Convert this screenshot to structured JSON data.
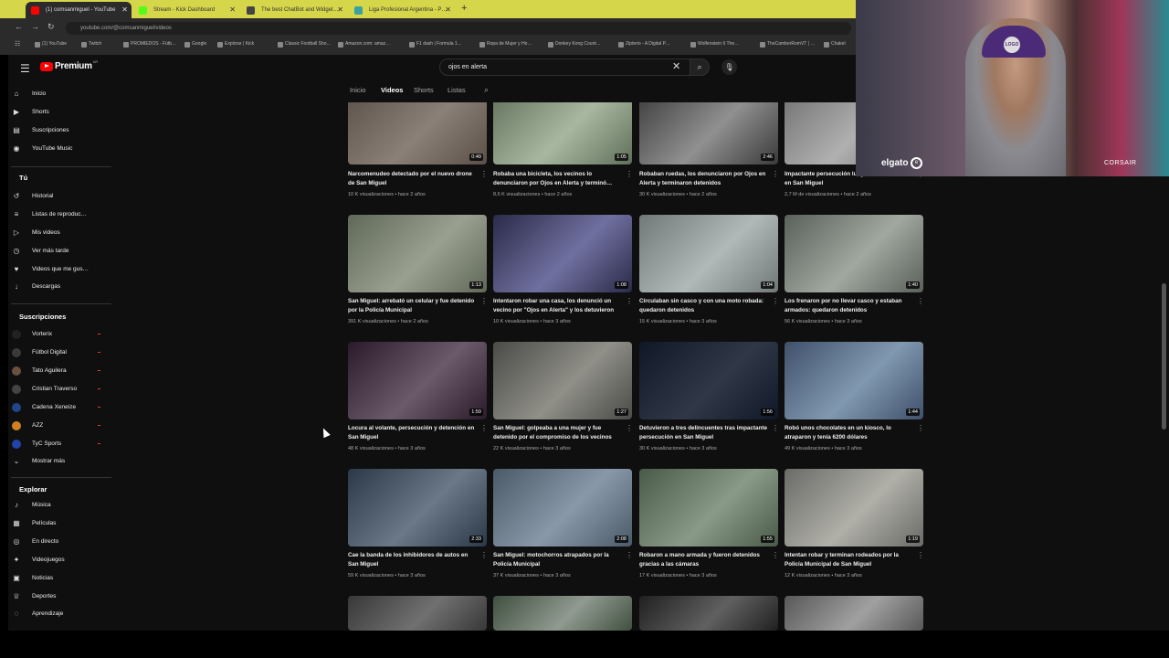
{
  "browser": {
    "tabs": [
      {
        "label": "(1) comsanmiguel - YouTube",
        "color": "#ff0000"
      },
      {
        "label": "Stream - Kick Dashboard",
        "color": "#53fc18"
      },
      {
        "label": "The best ChatBot and Widget…",
        "color": "#444444"
      },
      {
        "label": "Liga Profesional Argentina - P…",
        "color": "#3aa0a0"
      }
    ],
    "url": "youtube.com/@comsanmiguel/videos",
    "bookmarks": [
      "(1) YouTube",
      "Twitch",
      "PROMIEDOS - Fútb…",
      "Google",
      "Explorar | Kick",
      "Classic Football Sho…",
      "Amazon.com: amaz…",
      "F1 dash | Formula 1…",
      "Ropa de Mujer y Ho…",
      "Donkey Kong Count…",
      "Zipterio - A Digital P…",
      "Wolfenstein II The…",
      "TheCamberRomVT | …",
      "Chakel"
    ]
  },
  "header": {
    "logo": "Premium",
    "region": "AR",
    "search_value": "ojos en alerta"
  },
  "channel_tabs": [
    "Inicio",
    "Videos",
    "Shorts",
    "Listas"
  ],
  "sidebar": {
    "main": [
      "Inicio",
      "Shorts",
      "Suscripciones",
      "YouTube Music"
    ],
    "you_title": "Tú",
    "you": [
      "Historial",
      "Listas de reproduc…",
      "Mis videos",
      "Ver más tarde",
      "Videos que me gus…",
      "Descargas"
    ],
    "subs_title": "Suscripciones",
    "subs": [
      {
        "name": "Vorterix",
        "color": "#222222"
      },
      {
        "name": "Fútbol Digital",
        "color": "#3a3a3a"
      },
      {
        "name": "Tato Aguilera",
        "color": "#6a5040"
      },
      {
        "name": "Cristian Traverso",
        "color": "#444444"
      },
      {
        "name": "Cadena Xeneize",
        "color": "#224488"
      },
      {
        "name": "AZZ",
        "color": "#d08020"
      },
      {
        "name": "TyC Sports",
        "color": "#2244aa"
      }
    ],
    "show_more": "Mostrar más",
    "explore_title": "Explorar",
    "explore": [
      "Música",
      "Películas",
      "En directo",
      "Videojuegos",
      "Noticias",
      "Deportes",
      "Aprendizaje"
    ]
  },
  "videos": [
    {
      "title": "Narcomenudeo detectado por el nuevo drone de San Miguel",
      "meta": "10 K visualizaciones • hace 2 años",
      "duration": "0:49",
      "c1": "#5a5048",
      "c2": "#8a8078"
    },
    {
      "title": "Robaba una bicicleta, los vecinos lo denunciaron por Ojos en Alerta y terminó…",
      "meta": "8,6 K visualizaciones • hace 2 años",
      "duration": "1:05",
      "c1": "#5f6f5a",
      "c2": "#a8b8a0"
    },
    {
      "title": "Robaban ruedas, los denunciaron por Ojos en Alerta y terminaron detenidos",
      "meta": "30 K visualizaciones • hace 2 años",
      "duration": "2:46",
      "c1": "#3a3a3a",
      "c2": "#909090"
    },
    {
      "title": "Impactante persecución luego de una salidera en San Miguel",
      "meta": "2,7 M de visualizaciones • hace 2 años",
      "duration": "",
      "c1": "#707070",
      "c2": "#b0b0b0"
    },
    {
      "title": "San Miguel: arrebató un celular y fue detenido por la Policía Municipal",
      "meta": "391 K visualizaciones • hace 2 años",
      "duration": "1:13",
      "c1": "#606858",
      "c2": "#9aa090"
    },
    {
      "title": "Intentaron robar una casa, los denunció un vecino por \"Ojos en Alerta\" y los detuvieron",
      "meta": "10 K visualizaciones • hace 3 años",
      "duration": "1:08",
      "c1": "#2a2a48",
      "c2": "#7070a0"
    },
    {
      "title": "Circulaban sin casco y con una moto robada: quedaron detenidos",
      "meta": "15 K visualizaciones • hace 3 años",
      "duration": "1:04",
      "c1": "#707878",
      "c2": "#b0b8b8"
    },
    {
      "title": "Los frenaron por no llevar casco y estaban armados: quedaron detenidos",
      "meta": "56 K visualizaciones • hace 3 años",
      "duration": "1:40",
      "c1": "#5a605a",
      "c2": "#a0a8a0"
    },
    {
      "title": "Locura al volante, persecución y detención en San Miguel",
      "meta": "48 K visualizaciones • hace 3 años",
      "duration": "1:59",
      "c1": "#2a1a2a",
      "c2": "#6a5a6a"
    },
    {
      "title": "San Miguel: golpeaba a una mujer y fue detenido por el compromiso de los vecinos",
      "meta": "22 K visualizaciones • hace 3 años",
      "duration": "1:27",
      "c1": "#4a4a48",
      "c2": "#909088"
    },
    {
      "title": "Detuvieron a tres delincuentes tras impactante persecución en San Miguel",
      "meta": "30 K visualizaciones • hace 3 años",
      "duration": "1:56",
      "c1": "#101828",
      "c2": "#303848"
    },
    {
      "title": "Robó unos chocolates en un kiosco, lo atraparon y tenía 6200 dólares",
      "meta": "49 K visualizaciones • hace 3 años",
      "duration": "1:44",
      "c1": "#40506a",
      "c2": "#8098b0"
    },
    {
      "title": "Cae la banda de los inhibidores de autos en San Miguel",
      "meta": "59 K visualizaciones • hace 3 años",
      "duration": "2:33",
      "c1": "#2a3848",
      "c2": "#6a7888"
    },
    {
      "title": "San Miguel: motochorros atrapados por la Policía Municipal",
      "meta": "37 K visualizaciones • hace 3 años",
      "duration": "2:08",
      "c1": "#4a5a68",
      "c2": "#8898a8"
    },
    {
      "title": "Robaron a mano armada y fueron detenidos gracias a las cámaras",
      "meta": "17 K visualizaciones • hace 3 años",
      "duration": "1:55",
      "c1": "#4a5a48",
      "c2": "#8a9a88"
    },
    {
      "title": "Intentan robar y terminan rodeados por la Policía Municipal de San Miguel",
      "meta": "12 K visualizaciones • hace 3 años",
      "duration": "1:19",
      "c1": "#6a6a68",
      "c2": "#b0b0a8"
    },
    {
      "title": "",
      "meta": "",
      "duration": "",
      "c1": "#383838",
      "c2": "#707070"
    },
    {
      "title": "",
      "meta": "",
      "duration": "",
      "c1": "#405040",
      "c2": "#909a90"
    },
    {
      "title": "",
      "meta": "",
      "duration": "",
      "c1": "#202020",
      "c2": "#606060"
    },
    {
      "title": "",
      "meta": "",
      "duration": "",
      "c1": "#585858",
      "c2": "#a0a0a0"
    }
  ],
  "webcam": {
    "hat_logo": "LOGO",
    "brand1": "elgato",
    "brand2": "CORSAIR"
  }
}
